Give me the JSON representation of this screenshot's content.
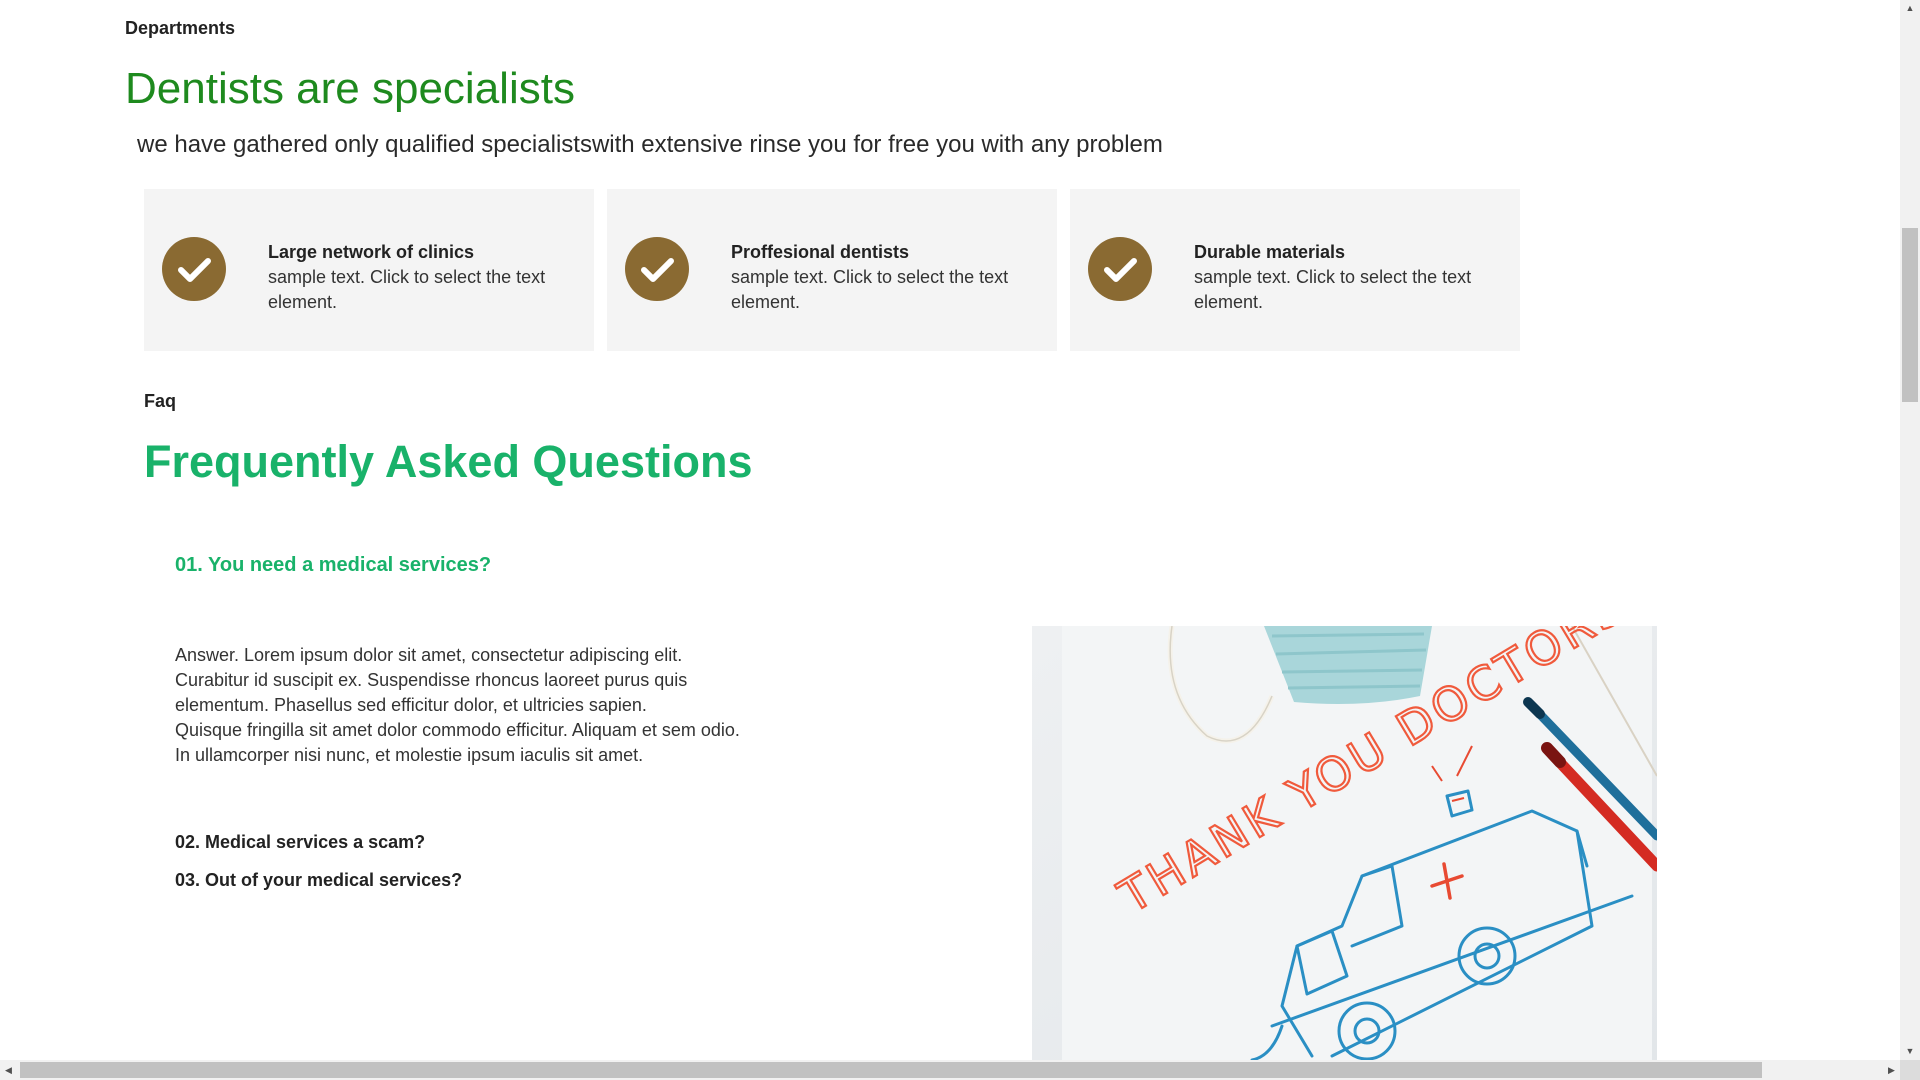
{
  "departments": {
    "label": "Departments",
    "title": "Dentists are specialists",
    "subtitle": "we have gathered only qualified specialistswith extensive rinse you for free you with any problem",
    "features": [
      {
        "title": "Large network of clinics",
        "text": "sample text. Click to select the text element.",
        "icon": "check-icon"
      },
      {
        "title": "Proffesional dentists",
        "text": "sample text. Click to select the text element.",
        "icon": "check-icon"
      },
      {
        "title": "Durable materials",
        "text": "sample text. Click to select the text element.",
        "icon": "check-icon"
      }
    ]
  },
  "faq": {
    "label": "Faq",
    "title": "Frequently Asked Questions",
    "questions": [
      {
        "q": "01. You need a medical services?",
        "answer_lines": [
          "Answer. Lorem ipsum dolor sit amet, consectetur adipiscing elit.",
          "Curabitur id suscipit ex. Suspendisse rhoncus laoreet purus quis",
          "elementum. Phasellus sed efficitur dolor, et ultricies sapien.",
          "Quisque fringilla sit amet dolor commodo efficitur. Aliquam et sem odio.",
          "In ullamcorper nisi nunc, et molestie ipsum iaculis sit amet."
        ]
      },
      {
        "q": "02. Medical services a scam?"
      },
      {
        "q": "03. Out of your medical services?"
      }
    ],
    "image": {
      "handwritten_text": "THANK YOU DOCTORS"
    }
  },
  "colors": {
    "dept_title": "#1e8a1e",
    "faq_accent": "#19b26a",
    "check_circle": "#8a6a32",
    "card_bg": "#f4f4f4"
  }
}
